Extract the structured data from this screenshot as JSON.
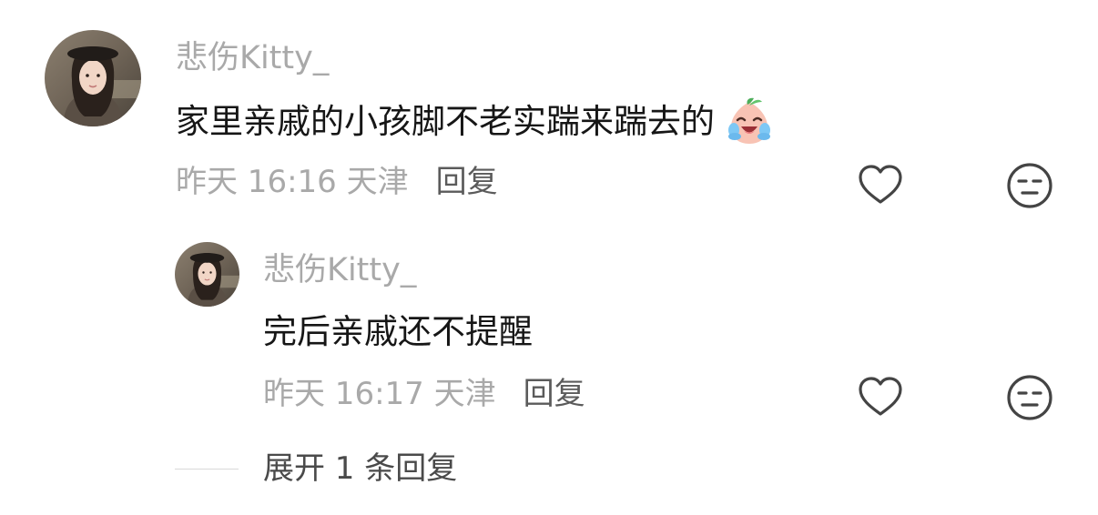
{
  "comments": [
    {
      "username": "悲伤Kitty_",
      "text": "家里亲戚的小孩脚不老实踹来踹去的",
      "emoji_icon": "laugh-cry-peach-emoji",
      "time_location": "昨天 16:16 天津",
      "reply_label": "回复",
      "like_icon": "heart-outline-icon",
      "dislike_icon": "unamused-face-icon"
    },
    {
      "username": "悲伤Kitty_",
      "text": "完后亲戚还不提醒",
      "time_location": "昨天 16:17 天津",
      "reply_label": "回复",
      "like_icon": "heart-outline-icon",
      "dislike_icon": "unamused-face-icon"
    }
  ],
  "expand_replies_label": "展开 1 条回复",
  "colors": {
    "username": "#a9a9a9",
    "text": "#161616",
    "meta": "#a9a9a9",
    "reply": "#5b5b5b",
    "icon": "#444444"
  }
}
